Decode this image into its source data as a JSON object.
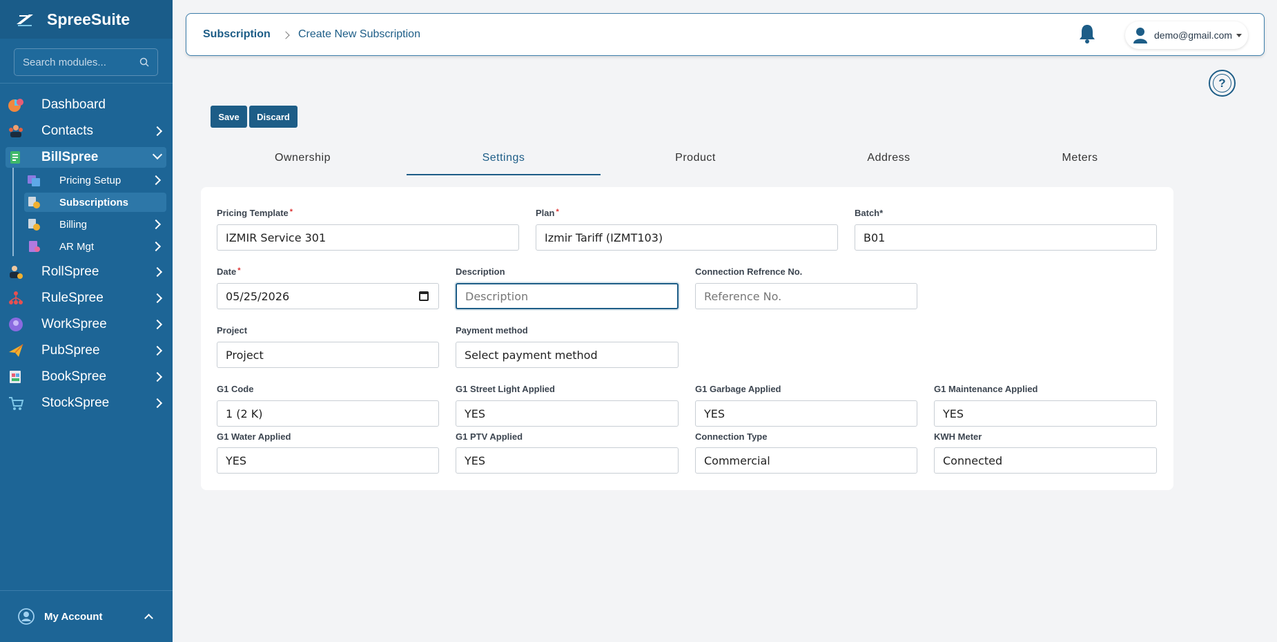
{
  "app": {
    "name": "SpreeSuite"
  },
  "sidebar": {
    "search_placeholder": "Search modules...",
    "items": [
      {
        "label": "Dashboard",
        "icon": "dashboard-icon"
      },
      {
        "label": "Contacts",
        "icon": "contacts-icon"
      },
      {
        "label": "BillSpree",
        "icon": "billspree-icon"
      },
      {
        "label": "RollSpree",
        "icon": "rollspree-icon"
      },
      {
        "label": "RuleSpree",
        "icon": "rulespree-icon"
      },
      {
        "label": "WorkSpree",
        "icon": "workspree-icon"
      },
      {
        "label": "PubSpree",
        "icon": "pubspree-icon"
      },
      {
        "label": "BookSpree",
        "icon": "bookspree-icon"
      },
      {
        "label": "StockSpree",
        "icon": "stockspree-icon"
      }
    ],
    "subitems": [
      {
        "label": "Pricing Setup"
      },
      {
        "label": "Subscriptions"
      },
      {
        "label": "Billing"
      },
      {
        "label": "AR Mgt"
      }
    ],
    "account_label": "My Account"
  },
  "header": {
    "breadcrumb_root": "Subscription",
    "breadcrumb_current": "Create New Subscription",
    "user_email": "demo@gmail.com"
  },
  "actions": {
    "save": "Save",
    "discard": "Discard"
  },
  "tabs": [
    "Ownership",
    "Settings",
    "Product",
    "Address",
    "Meters"
  ],
  "active_tab": "Settings",
  "form": {
    "pricing_template": {
      "label": "Pricing Template",
      "value": "IZMIR Service 301"
    },
    "plan": {
      "label": "Plan",
      "value": "Izmir Tariff (IZMT103)"
    },
    "batch": {
      "label": "Batch*",
      "value": "B01"
    },
    "date": {
      "label": "Date",
      "value": "05/25/2026"
    },
    "description": {
      "label": "Description",
      "placeholder": "Description"
    },
    "connection_ref": {
      "label": "Connection Refrence No.",
      "placeholder": "Reference No."
    },
    "project": {
      "label": "Project",
      "value": "Project"
    },
    "payment_method": {
      "label": "Payment method",
      "value": "Select payment method"
    },
    "g1_code": {
      "label": "G1 Code",
      "value": "1 (2 K)"
    },
    "g1_street_light": {
      "label": "G1 Street Light Applied",
      "value": "YES"
    },
    "g1_garbage": {
      "label": "G1 Garbage Applied",
      "value": "YES"
    },
    "g1_maintenance": {
      "label": "G1 Maintenance Applied",
      "value": "YES"
    },
    "g1_water": {
      "label": "G1 Water Applied",
      "value": "YES"
    },
    "g1_ptv": {
      "label": "G1 PTV Applied",
      "value": "YES"
    },
    "connection_type": {
      "label": "Connection Type",
      "value": "Commercial"
    },
    "kwh_meter": {
      "label": "KWH Meter",
      "value": "Connected"
    }
  },
  "colors": {
    "sidebar": "#1d6596",
    "accent": "#1d5d87",
    "required": "#dd3333"
  }
}
